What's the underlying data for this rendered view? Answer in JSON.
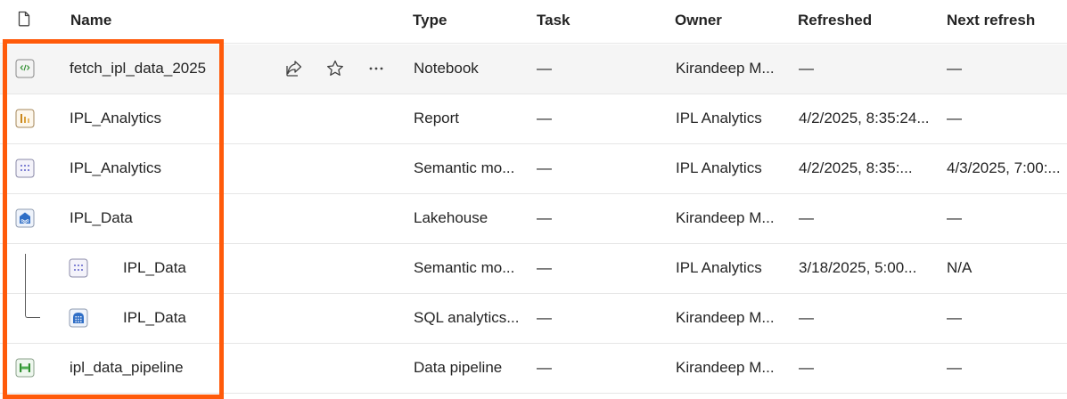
{
  "header": {
    "name": "Name",
    "type": "Type",
    "task": "Task",
    "owner": "Owner",
    "refreshed": "Refreshed",
    "next_refresh": "Next refresh"
  },
  "rows": [
    {
      "name": "fetch_ipl_data_2025",
      "type": "Notebook",
      "task": "—",
      "owner": "Kirandeep M...",
      "refreshed": "—",
      "next": "—",
      "icon": "notebook-icon",
      "selected": true
    },
    {
      "name": "IPL_Analytics",
      "type": "Report",
      "task": "—",
      "owner": "IPL Analytics",
      "refreshed": "4/2/2025, 8:35:24...",
      "next": "—",
      "icon": "report-icon"
    },
    {
      "name": "IPL_Analytics",
      "type": "Semantic mo...",
      "task": "—",
      "owner": "IPL Analytics",
      "refreshed": "4/2/2025, 8:35:...",
      "next": "4/3/2025, 7:00:...",
      "icon": "semantic-model-icon"
    },
    {
      "name": "IPL_Data",
      "type": "Lakehouse",
      "task": "—",
      "owner": "Kirandeep M...",
      "refreshed": "—",
      "next": "—",
      "icon": "lakehouse-icon"
    },
    {
      "name": "IPL_Data",
      "type": "Semantic mo...",
      "task": "—",
      "owner": "IPL Analytics",
      "refreshed": "3/18/2025, 5:00...",
      "next": "N/A",
      "icon": "semantic-model-icon",
      "child": true
    },
    {
      "name": "IPL_Data",
      "type": "SQL analytics...",
      "task": "—",
      "owner": "Kirandeep M...",
      "refreshed": "—",
      "next": "—",
      "icon": "sql-endpoint-icon",
      "child": true
    },
    {
      "name": "ipl_data_pipeline",
      "type": "Data pipeline",
      "task": "—",
      "owner": "Kirandeep M...",
      "refreshed": "—",
      "next": "—",
      "icon": "pipeline-icon"
    }
  ],
  "row_actions": [
    "share-icon",
    "star-icon",
    "more-options-icon"
  ],
  "colors": {
    "highlight": "#ff5a0a",
    "selected_row": "#f5f5f5",
    "divider": "#e6e6e6"
  }
}
